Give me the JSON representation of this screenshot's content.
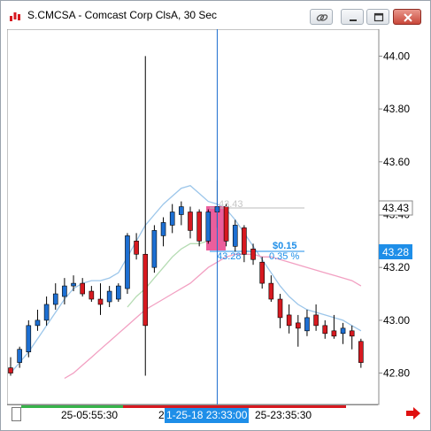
{
  "window": {
    "title": "S.CMCSA - Comcast Corp ClsA, 30 Sec"
  },
  "colors": {
    "up_candle": "#1d6fd2",
    "down_candle": "#d71920",
    "crosshair": "#1e6fd0",
    "ma_light_blue": "#9cc6ea",
    "ma_light_green": "#b5dcb3",
    "ma_pink": "#f2a0c2",
    "highlight": "#e8428b",
    "measure_text": "#1e8ee8",
    "price_tag_bg": "#1e8ee8"
  },
  "price_axis": {
    "ticks": [
      "44.00",
      "43.80",
      "43.60",
      "43.40",
      "43.20",
      "43.00",
      "42.80"
    ],
    "current_price_tag": "43.28",
    "cursor_price_tag": "43.43"
  },
  "time_axis": {
    "labels": [
      "25-05:55:30",
      "2",
      "25-23:35:30"
    ],
    "cursor_time_tag": "1-25-18 23:33:00"
  },
  "measure_tool": {
    "start_price_label": "43.43",
    "end_price_label": "43.28",
    "change_label": "$0.15",
    "percent_label": "0.35 %"
  },
  "chart_data": {
    "type": "candlestick",
    "title": "S.CMCSA - Comcast Corp ClsA, 30 Sec",
    "ylim": [
      42.75,
      44.05
    ],
    "candles": [
      {
        "o": 42.82,
        "h": 42.86,
        "l": 42.79,
        "c": 42.8
      },
      {
        "o": 42.84,
        "h": 42.9,
        "l": 42.82,
        "c": 42.89
      },
      {
        "o": 42.88,
        "h": 43.0,
        "l": 42.86,
        "c": 42.98
      },
      {
        "o": 42.98,
        "h": 43.04,
        "l": 42.96,
        "c": 43.0
      },
      {
        "o": 43.0,
        "h": 43.09,
        "l": 42.98,
        "c": 43.06
      },
      {
        "o": 43.06,
        "h": 43.14,
        "l": 43.04,
        "c": 43.1
      },
      {
        "o": 43.09,
        "h": 43.16,
        "l": 43.06,
        "c": 43.13
      },
      {
        "o": 43.13,
        "h": 43.17,
        "l": 43.11,
        "c": 43.14
      },
      {
        "o": 43.14,
        "h": 43.16,
        "l": 43.09,
        "c": 43.1
      },
      {
        "o": 43.11,
        "h": 43.13,
        "l": 43.07,
        "c": 43.08
      },
      {
        "o": 43.08,
        "h": 43.14,
        "l": 43.02,
        "c": 43.06
      },
      {
        "o": 43.07,
        "h": 43.13,
        "l": 43.05,
        "c": 43.11
      },
      {
        "o": 43.08,
        "h": 43.14,
        "l": 43.07,
        "c": 43.13
      },
      {
        "o": 43.12,
        "h": 43.33,
        "l": 43.1,
        "c": 43.32
      },
      {
        "o": 43.3,
        "h": 43.33,
        "l": 43.23,
        "c": 43.25
      },
      {
        "o": 43.25,
        "h": 44.0,
        "l": 42.79,
        "c": 42.98
      },
      {
        "o": 43.2,
        "h": 43.36,
        "l": 43.18,
        "c": 43.34
      },
      {
        "o": 43.32,
        "h": 43.39,
        "l": 43.28,
        "c": 43.37
      },
      {
        "o": 43.36,
        "h": 43.44,
        "l": 43.33,
        "c": 43.41
      },
      {
        "o": 43.4,
        "h": 43.45,
        "l": 43.36,
        "c": 43.43
      },
      {
        "o": 43.41,
        "h": 43.43,
        "l": 43.31,
        "c": 43.34
      },
      {
        "o": 43.41,
        "h": 43.42,
        "l": 43.28,
        "c": 43.3
      },
      {
        "o": 43.3,
        "h": 43.42,
        "l": 43.29,
        "c": 43.41
      },
      {
        "o": 43.41,
        "h": 43.53,
        "l": 43.35,
        "c": 43.43
      },
      {
        "o": 43.43,
        "h": 43.44,
        "l": 43.28,
        "c": 43.3
      },
      {
        "o": 43.28,
        "h": 43.38,
        "l": 43.26,
        "c": 43.36
      },
      {
        "o": 43.35,
        "h": 43.36,
        "l": 43.22,
        "c": 43.25
      },
      {
        "o": 43.27,
        "h": 43.29,
        "l": 43.21,
        "c": 43.23
      },
      {
        "o": 43.22,
        "h": 43.24,
        "l": 43.12,
        "c": 43.14
      },
      {
        "o": 43.14,
        "h": 43.17,
        "l": 43.07,
        "c": 43.08
      },
      {
        "o": 43.08,
        "h": 43.1,
        "l": 42.97,
        "c": 43.01
      },
      {
        "o": 43.02,
        "h": 43.06,
        "l": 42.95,
        "c": 42.98
      },
      {
        "o": 42.99,
        "h": 43.02,
        "l": 42.9,
        "c": 42.97
      },
      {
        "o": 42.96,
        "h": 43.04,
        "l": 42.94,
        "c": 43.01
      },
      {
        "o": 43.02,
        "h": 43.06,
        "l": 42.96,
        "c": 42.98
      },
      {
        "o": 42.98,
        "h": 43.0,
        "l": 42.93,
        "c": 42.95
      },
      {
        "o": 42.96,
        "h": 43.02,
        "l": 42.93,
        "c": 42.94
      },
      {
        "o": 42.95,
        "h": 42.99,
        "l": 42.91,
        "c": 42.97
      },
      {
        "o": 42.96,
        "h": 42.98,
        "l": 42.89,
        "c": 42.94
      },
      {
        "o": 42.92,
        "h": 42.93,
        "l": 42.82,
        "c": 42.84
      }
    ],
    "ma_blue": [
      42.8,
      42.84,
      42.88,
      42.93,
      42.98,
      43.03,
      43.08,
      43.12,
      43.14,
      43.15,
      43.15,
      43.16,
      43.18,
      43.24,
      43.3,
      43.36,
      43.4,
      43.44,
      43.47,
      43.5,
      43.51,
      43.48,
      43.45,
      43.44,
      43.42,
      43.38,
      43.33,
      43.28,
      43.23,
      43.18,
      43.13,
      43.09,
      43.06,
      43.04,
      43.03,
      43.02,
      43.01,
      43.0,
      42.98,
      42.96
    ],
    "ma_green": [
      null,
      null,
      null,
      null,
      null,
      null,
      null,
      null,
      null,
      null,
      null,
      null,
      null,
      43.05,
      43.09,
      43.12,
      43.16,
      43.2,
      43.24,
      43.27,
      43.29,
      43.29,
      43.3,
      null,
      null,
      null,
      null,
      null,
      null,
      null,
      null,
      null,
      null,
      null,
      null,
      null,
      null,
      null,
      null,
      null
    ],
    "ma_pink": [
      null,
      null,
      null,
      null,
      null,
      null,
      42.78,
      42.8,
      42.83,
      42.86,
      42.89,
      42.92,
      42.95,
      42.98,
      43.01,
      43.04,
      43.06,
      43.08,
      43.1,
      43.12,
      43.14,
      43.17,
      43.2,
      43.22,
      43.24,
      43.25,
      43.25,
      43.25,
      43.24,
      43.24,
      43.23,
      43.22,
      43.21,
      43.2,
      43.19,
      43.18,
      43.17,
      43.16,
      43.15,
      43.13
    ],
    "crosshair_index": 23
  }
}
